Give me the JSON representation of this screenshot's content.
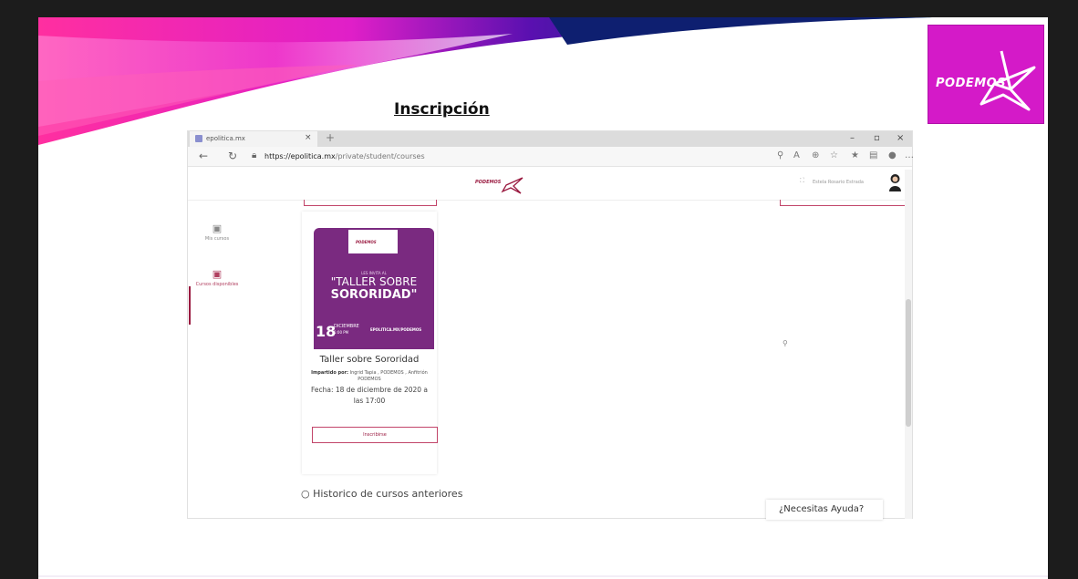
{
  "slide": {
    "heading": "Inscripción",
    "logo_text": "PODEMOS"
  },
  "browser": {
    "tab_title": "epolitica.mx",
    "tab_close": "×",
    "new_tab": "+",
    "url_host": "https://epolitica.mx",
    "url_path": "/private/student/courses",
    "win_min": "–",
    "win_max": "▫",
    "win_close": "×"
  },
  "site": {
    "logo_text": "PODEMOS",
    "user_name": "Estela Rosario Estrada"
  },
  "sidebar": {
    "items": [
      {
        "label": "Mis cursos"
      },
      {
        "label": "Cursos disponibles"
      }
    ]
  },
  "course": {
    "poster_logo": "PODEMOS",
    "poster_subtitle": "LES INVITA AL",
    "poster_line1": "\"TALLER SOBRE",
    "poster_line2": "SORORIDAD\"",
    "poster_day": "18",
    "poster_month": "DICIEMBRE",
    "poster_time": "5:00 PM",
    "poster_web": "EPOLITICA.MX/PODEMOS",
    "title": "Taller sobre Sororidad",
    "by_label": "Impartido por:",
    "by_value": "Ingrid Tapia , PODEMOS , Anfitrión PODEMOS",
    "date": "Fecha: 18 de diciembre de 2020 a las 17:00",
    "button": "Inscribirse"
  },
  "history": {
    "label": "Historico de cursos anteriores"
  },
  "help": {
    "label": "¿Necesitas Ayuda?"
  },
  "colors": {
    "brand_magenta": "#d41ac8",
    "brand_maroon": "#9a1a40",
    "poster_purple": "#7a2a80"
  }
}
